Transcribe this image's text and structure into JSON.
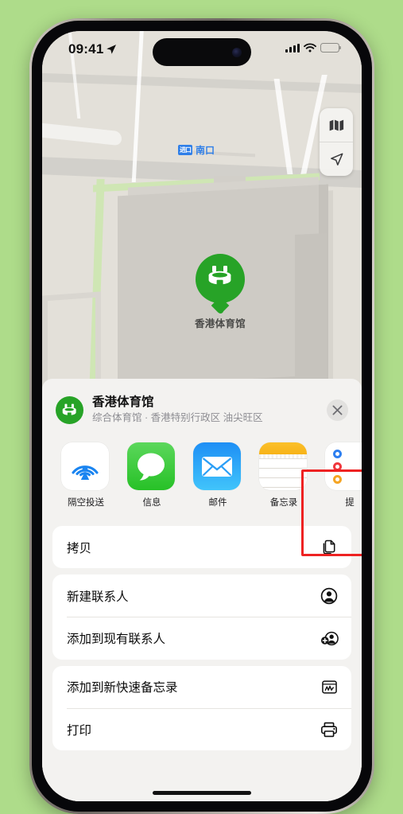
{
  "background_color": "#aedc8a",
  "status_bar": {
    "time": "09:41",
    "location_arrow": "location-arrow-icon",
    "cellular": "signal-bars-icon",
    "wifi": "wifi-icon",
    "battery": "battery-icon"
  },
  "map": {
    "transit_badge": "进口",
    "transit_label": "南口",
    "poi_label": "香港体育馆",
    "pin_icon": "stadium-icon",
    "controls": [
      {
        "name": "map-style-button",
        "icon": "folded-map-icon"
      },
      {
        "name": "locate-me-button",
        "icon": "location-arrow-icon"
      }
    ]
  },
  "share_sheet": {
    "title": "香港体育馆",
    "subtitle": "综合体育馆 · 香港特别行政区 油尖旺区",
    "avatar_icon": "stadium-icon",
    "close_label": "✕",
    "apps": [
      {
        "name": "隔空投送",
        "icon": "airdrop-icon",
        "highlighted": false
      },
      {
        "name": "信息",
        "icon": "messages-icon",
        "highlighted": false
      },
      {
        "name": "邮件",
        "icon": "mail-icon",
        "highlighted": false
      },
      {
        "name": "备忘录",
        "icon": "notes-icon",
        "highlighted": true
      },
      {
        "name": "提",
        "icon": "reminders-icon",
        "highlighted": false
      }
    ],
    "highlight_color": "#ee2222",
    "actions": [
      {
        "label": "拷贝",
        "icon": "copy-icon"
      },
      {
        "label": "新建联系人",
        "icon": "person-circle-icon"
      },
      {
        "label": "添加到现有联系人",
        "icon": "person-badge-plus-icon"
      },
      {
        "label": "添加到新快速备忘录",
        "icon": "quick-note-icon"
      },
      {
        "label": "打印",
        "icon": "printer-icon"
      }
    ]
  }
}
